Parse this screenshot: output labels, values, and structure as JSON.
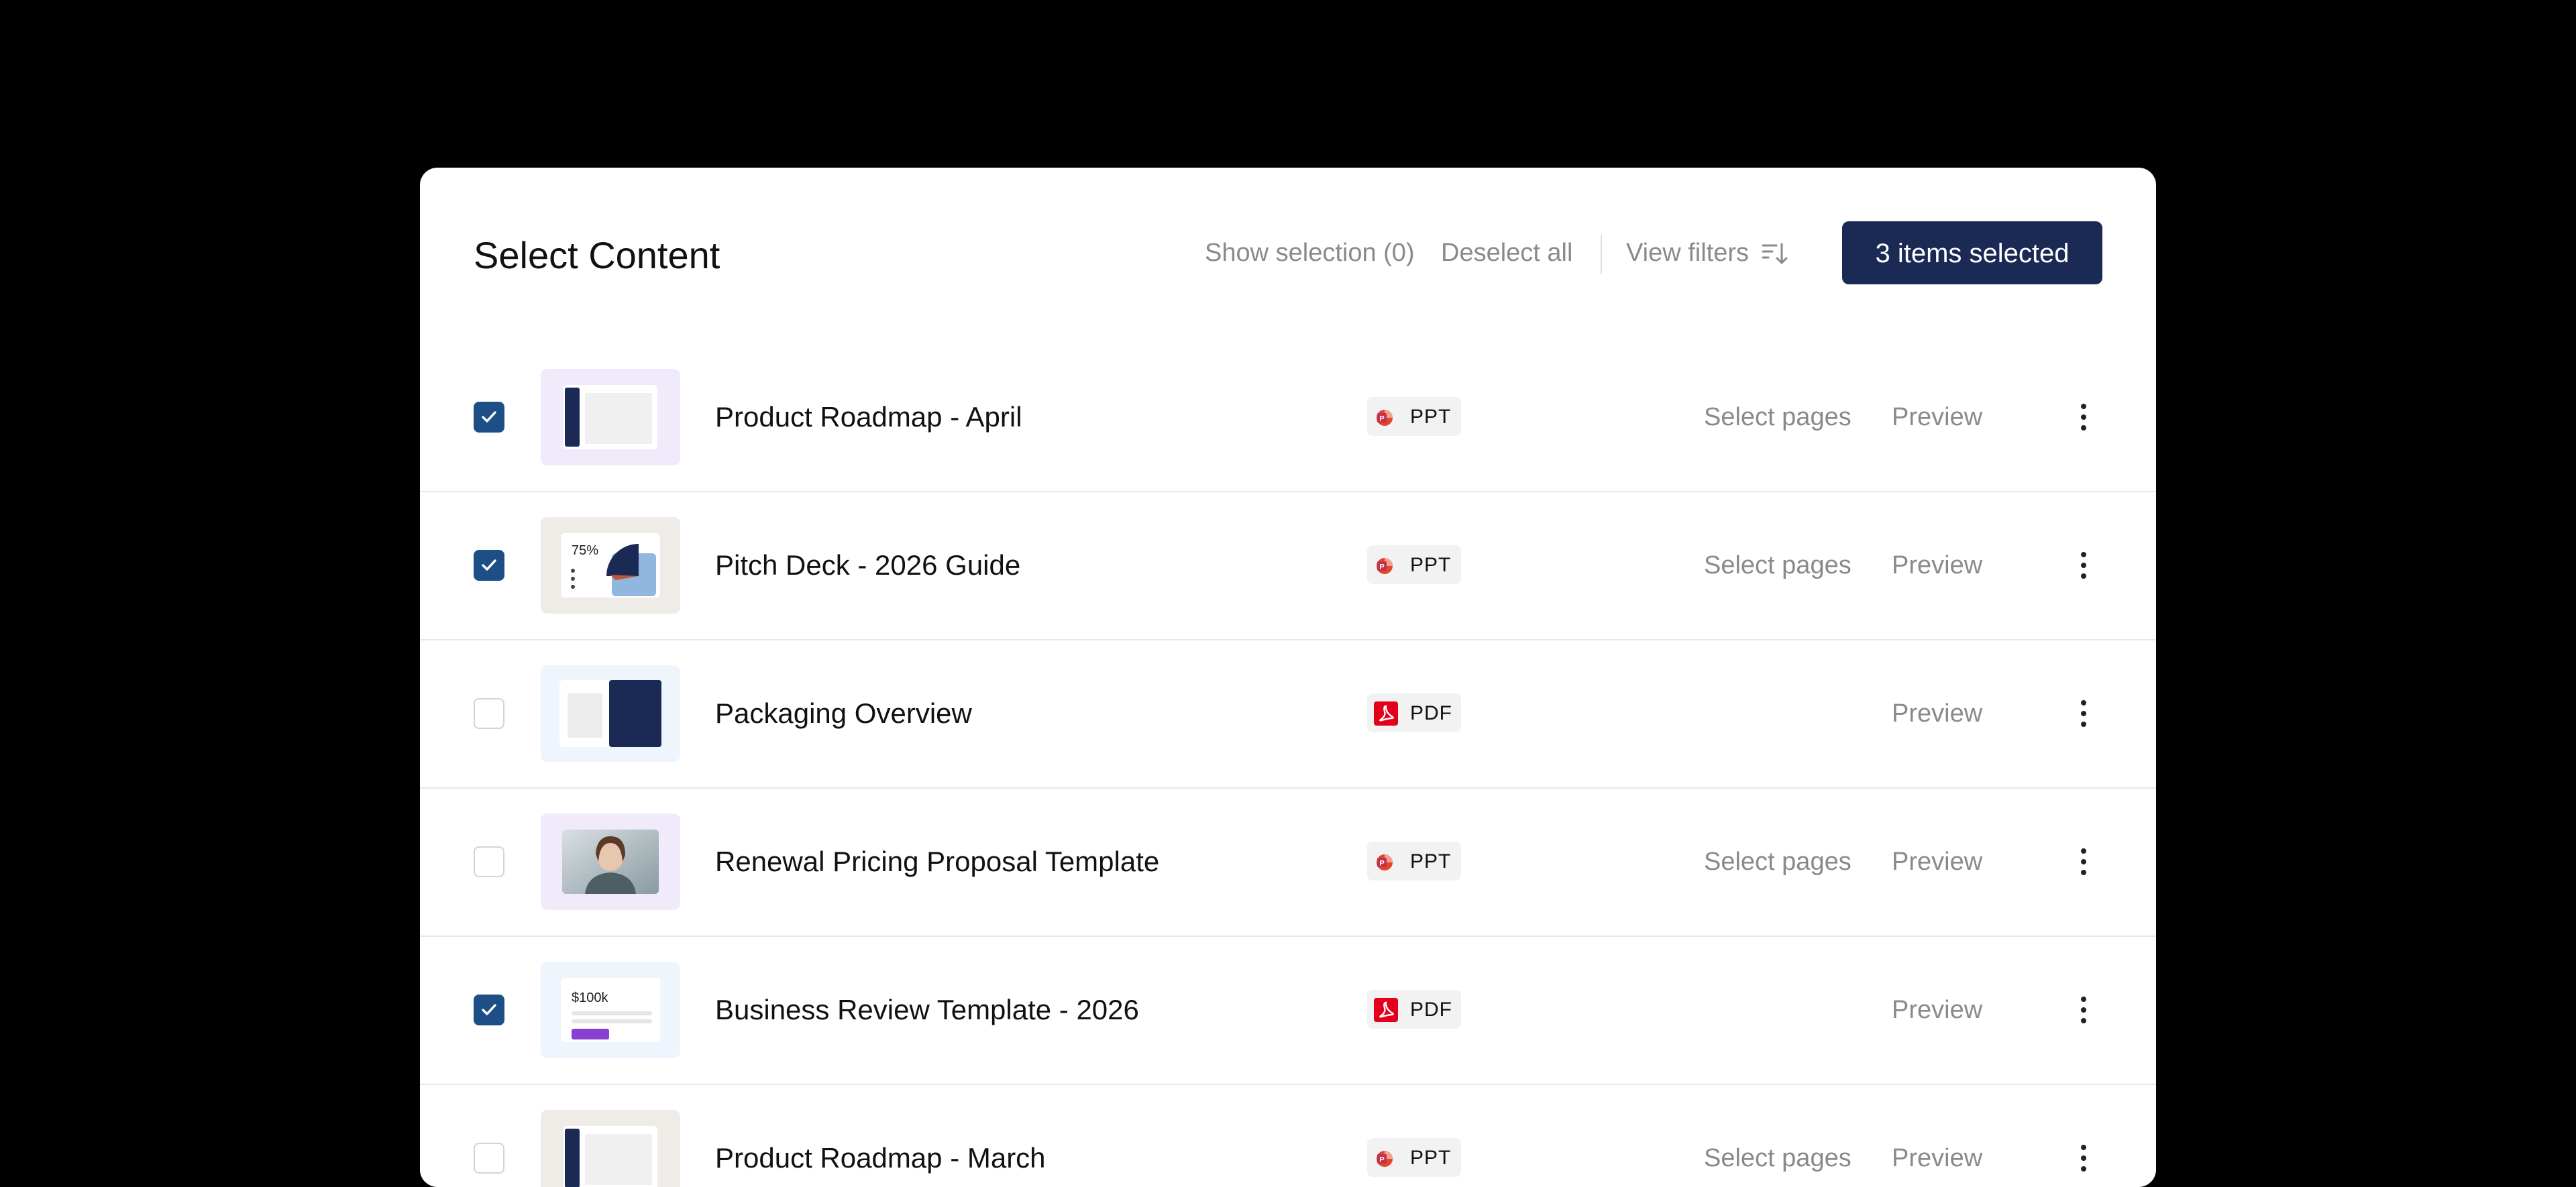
{
  "header": {
    "title": "Select Content",
    "show_selection": "Show selection (0)",
    "deselect_all": "Deselect all",
    "view_filters": "View filters",
    "selected_button": "3 items selected"
  },
  "colors": {
    "primary": "#1b2a55",
    "checkbox_checked": "#1d4f86",
    "pdf_red": "#e3001b",
    "ppt_red": "#e2472c"
  },
  "actions": {
    "select_pages": "Select pages",
    "preview": "Preview"
  },
  "rows": [
    {
      "name": "Product Roadmap - April",
      "type": "PPT",
      "checked": true,
      "thumb": "roadmap-lavender",
      "has_select_pages": true
    },
    {
      "name": "Pitch Deck - 2026 Guide",
      "type": "PPT",
      "checked": true,
      "thumb": "pitch-chart",
      "thumb_text": "75%",
      "has_select_pages": true
    },
    {
      "name": "Packaging Overview",
      "type": "PDF",
      "checked": false,
      "thumb": "packaging-blue",
      "has_select_pages": false
    },
    {
      "name": "Renewal Pricing Proposal Template",
      "type": "PPT",
      "checked": false,
      "thumb": "photo-person",
      "has_select_pages": true
    },
    {
      "name": "Business Review Template - 2026",
      "type": "PDF",
      "checked": true,
      "thumb": "review-money",
      "thumb_text": "$100k",
      "has_select_pages": false
    },
    {
      "name": "Product Roadmap - March",
      "type": "PPT",
      "checked": false,
      "thumb": "roadmap-beige",
      "has_select_pages": true
    }
  ]
}
